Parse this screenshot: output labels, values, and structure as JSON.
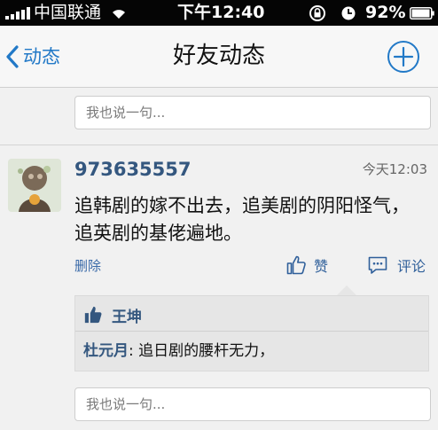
{
  "status_bar": {
    "carrier": "中国联通",
    "time": "下午12:40",
    "battery_percent": "92%"
  },
  "nav": {
    "back_label": "动态",
    "title": "好友动态"
  },
  "top_comment_input": {
    "placeholder": "我也说一句..."
  },
  "post": {
    "username": "973635557",
    "time": "今天12:03",
    "body": "追韩剧的嫁不出去，追美剧的阴阳怪气，追英剧的基佬遍地。",
    "actions": {
      "delete_label": "删除",
      "like_label": "赞",
      "comment_label": "评论"
    },
    "likes": [
      "王坤"
    ],
    "comments": [
      {
        "author": "杜元月",
        "separator": ": ",
        "text": "追日剧的腰杆无力，"
      }
    ]
  },
  "bottom_comment_input": {
    "placeholder": "我也说一句..."
  },
  "colors": {
    "accent": "#2279c7",
    "username": "#34577f",
    "status_bar": "#050505"
  }
}
